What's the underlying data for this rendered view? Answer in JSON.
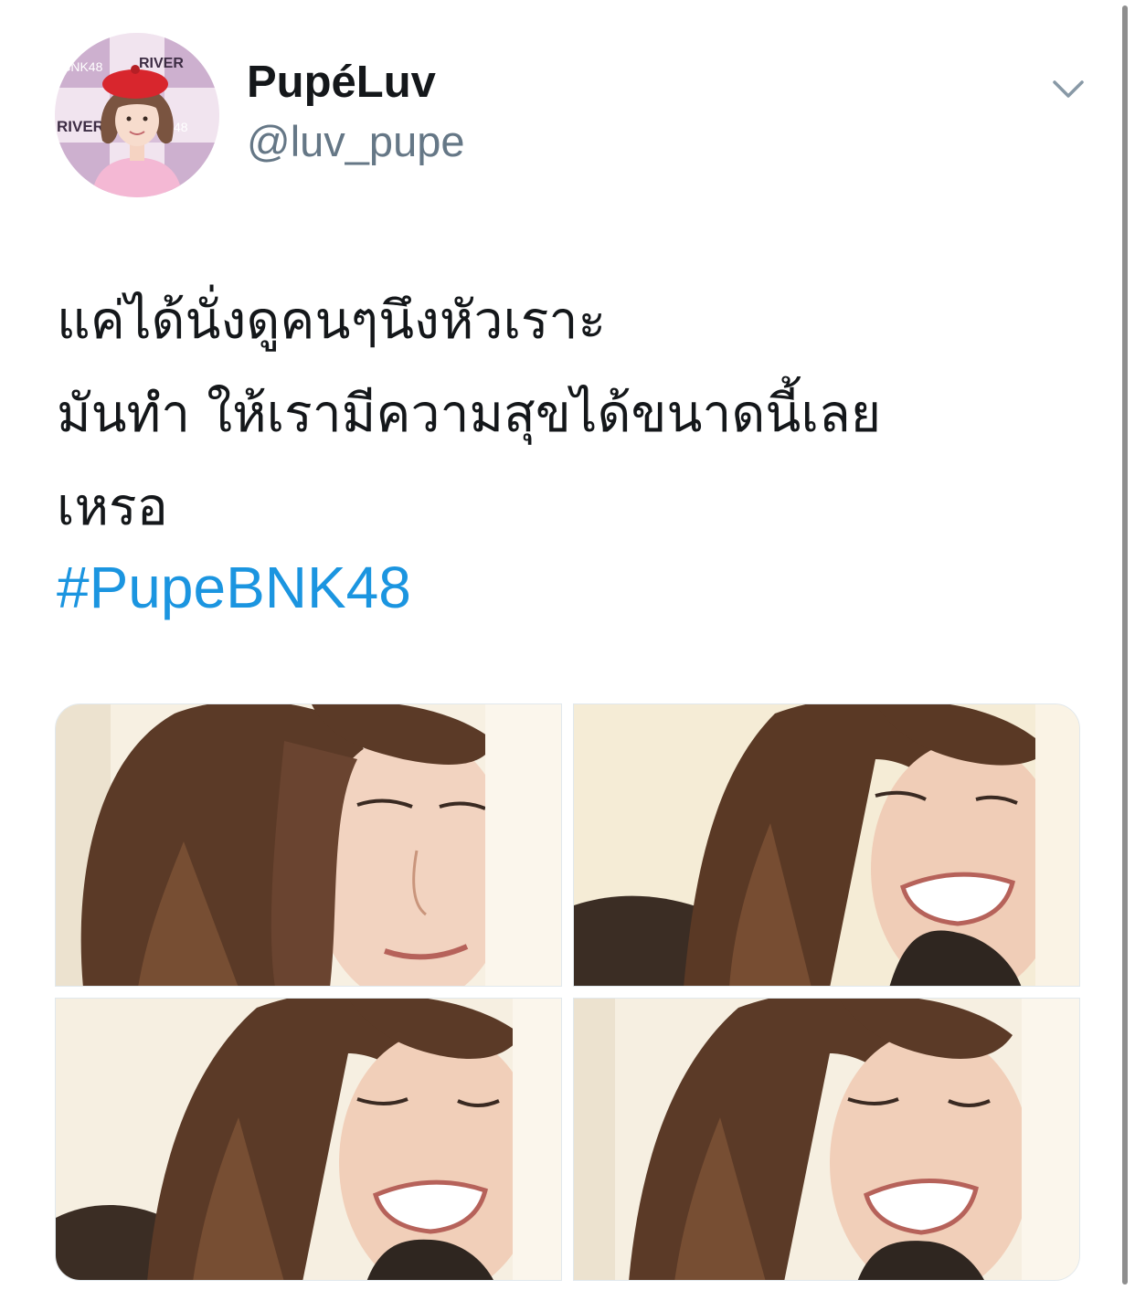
{
  "tweet": {
    "display_name": "PupéLuv",
    "handle": "@luv_pupe",
    "text_lines": [
      "แค่ได้นั่งดูคนๆนึงหัวเราะ",
      "มันทำ ให้เรามีความสุขได้ขนาดนี้เลย",
      "เหรอ"
    ],
    "hashtag": "#PupeBNK48"
  },
  "avatar": {
    "backdrop_text_1": "RIVER",
    "backdrop_text_2": "RIVER",
    "backdrop_text_3": "BNK48",
    "backdrop_text_4": "48"
  },
  "icons": {
    "menu": "chevron-down-icon"
  },
  "media": {
    "count": 4
  },
  "colors": {
    "name": "#14171a",
    "handle": "#657786",
    "hashtag": "#1b95e0",
    "border": "#e1e8ed"
  }
}
